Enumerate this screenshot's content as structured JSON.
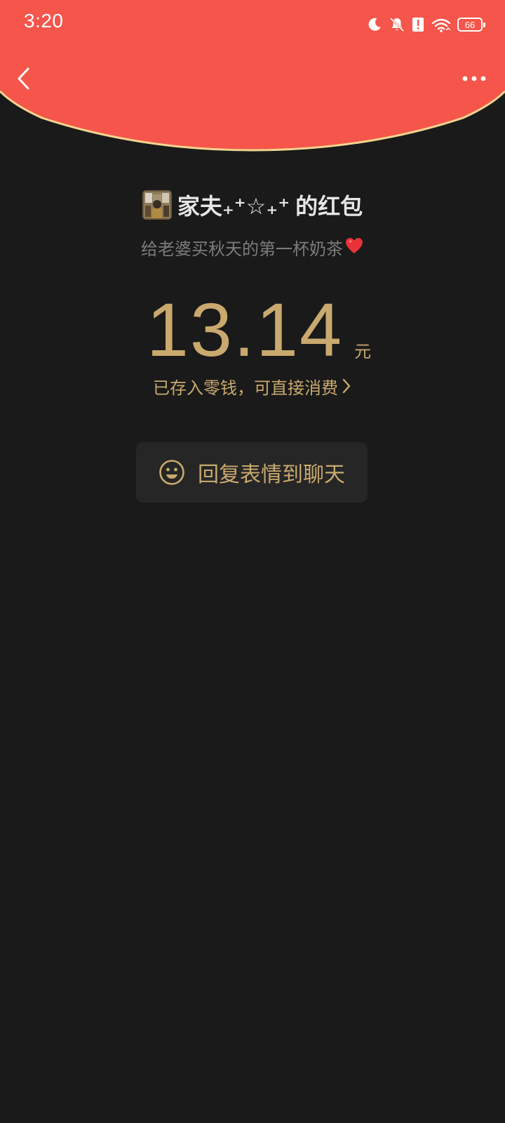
{
  "status_bar": {
    "time": "3:20",
    "battery": "66",
    "icons": [
      "moon-icon",
      "bell-off-icon",
      "alert-icon",
      "wifi-icon",
      "battery-icon"
    ]
  },
  "header": {
    "back_icon": "chevron-left-icon",
    "more_icon": "more-horizontal-icon",
    "color": "#f5554a",
    "border_color": "#f5d58f"
  },
  "red_packet": {
    "sender_name": "家夫₊⁺☆₊⁺",
    "sender_suffix": "的红包",
    "blessing": "给老婆买秋天的第一杯奶茶",
    "blessing_emoji": "heart-icon",
    "amount": "13.14",
    "currency": "元",
    "status_text": "已存入零钱，可直接消费",
    "status_icon": "chevron-right-icon",
    "reply_label": "回复表情到聊天",
    "reply_icon": "smiley-icon"
  },
  "colors": {
    "background": "#1a1a1a",
    "gold": "#c9a96e",
    "title": "#e6e6e6",
    "subtitle": "#7c7c7c",
    "button_bg": "#262626"
  }
}
